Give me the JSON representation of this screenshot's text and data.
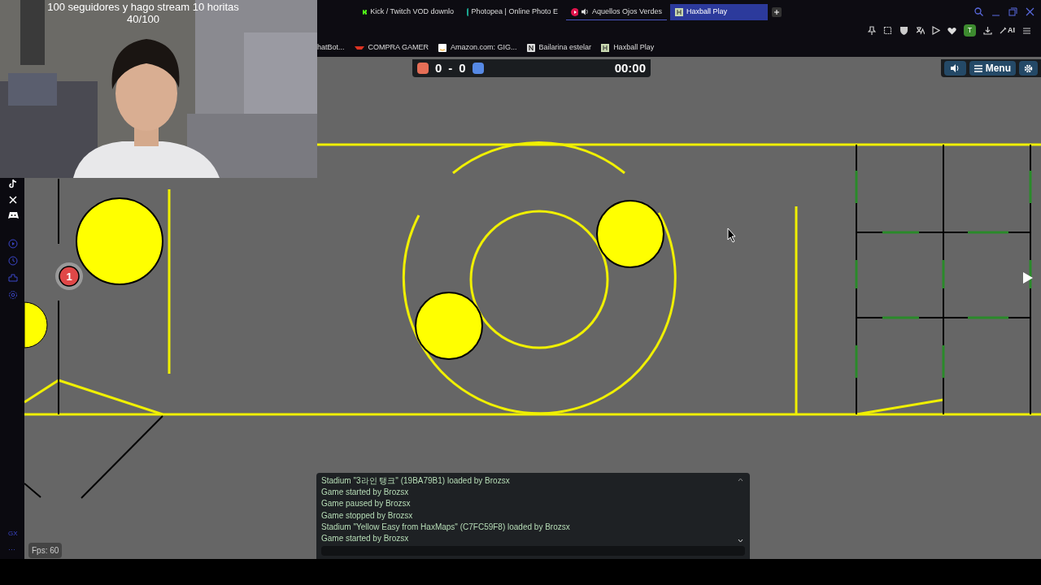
{
  "stream_overlay": {
    "lines": [
      "100 seguidores y hago stream 10 horitas",
      "40/100"
    ]
  },
  "tabs": [
    {
      "label": "Kick / Twitch VOD downlo",
      "selected": false
    },
    {
      "label": "Photopea | Online Photo E",
      "selected": false
    },
    {
      "label": "Aquellos Ojos Verdes",
      "selected": false
    },
    {
      "label": "Haxball Play",
      "selected": true
    }
  ],
  "toolbar": {
    "profile": "T",
    "ai": "AI"
  },
  "bookmarks": [
    {
      "label": "hatBot..."
    },
    {
      "label": "COMPRA GAMER"
    },
    {
      "label": "Amazon.com: GIG..."
    },
    {
      "label": "Bailarina estelar"
    },
    {
      "label": "Haxball Play"
    }
  ],
  "sidebar": {
    "bottom_label": "GX",
    "more": "···"
  },
  "scoreboard": {
    "red": "0",
    "separator": "-",
    "blue": "0",
    "time": "00:00"
  },
  "game_menu": {
    "menu": "Menu"
  },
  "player": {
    "number": "1"
  },
  "chat": {
    "messages": [
      "Stadium \"3라인 탱크\" (19BA79B1) loaded by Brozsx",
      "Game started by Brozsx",
      "Game paused by Brozsx",
      "Game stopped by Brozsx",
      "Stadium \"Yellow Easy from HaxMaps\" (C7FC59F8) loaded by Brozsx",
      "Game started by Brozsx"
    ]
  },
  "fps": "Fps: 60"
}
